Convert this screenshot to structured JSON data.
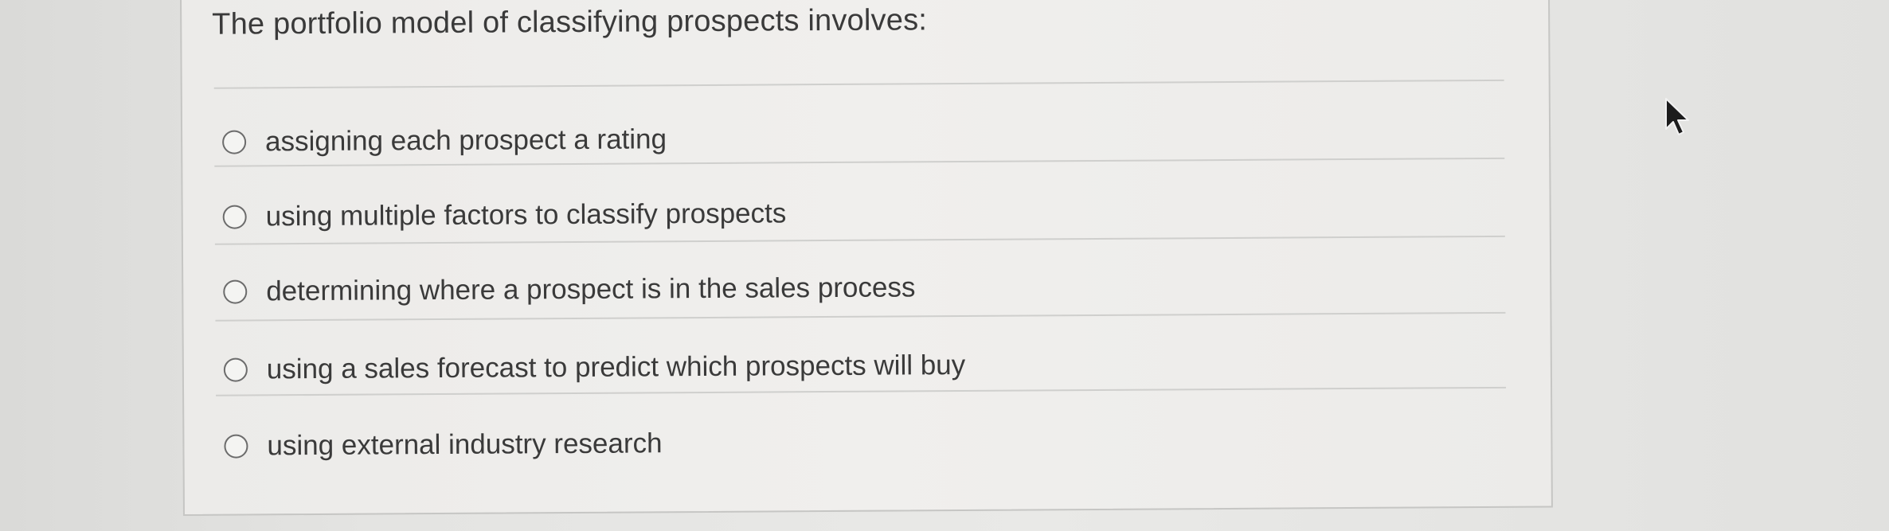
{
  "question": {
    "text": "The portfolio model of classifying prospects involves:"
  },
  "options": [
    {
      "label": "assigning each prospect a rating",
      "selected": false
    },
    {
      "label": "using multiple factors to classify prospects",
      "selected": false
    },
    {
      "label": "determining where a prospect is in the sales process",
      "selected": false
    },
    {
      "label": "using a sales forecast to predict which prospects will buy",
      "selected": false
    },
    {
      "label": "using external industry research",
      "selected": false
    }
  ],
  "icons": {
    "cursor": "mouse-pointer-icon",
    "radio": "radio-button-icon"
  },
  "colors": {
    "text": "#3a3a3a",
    "divider": "#cfcfcd",
    "radio_border": "#6c6c6c"
  }
}
